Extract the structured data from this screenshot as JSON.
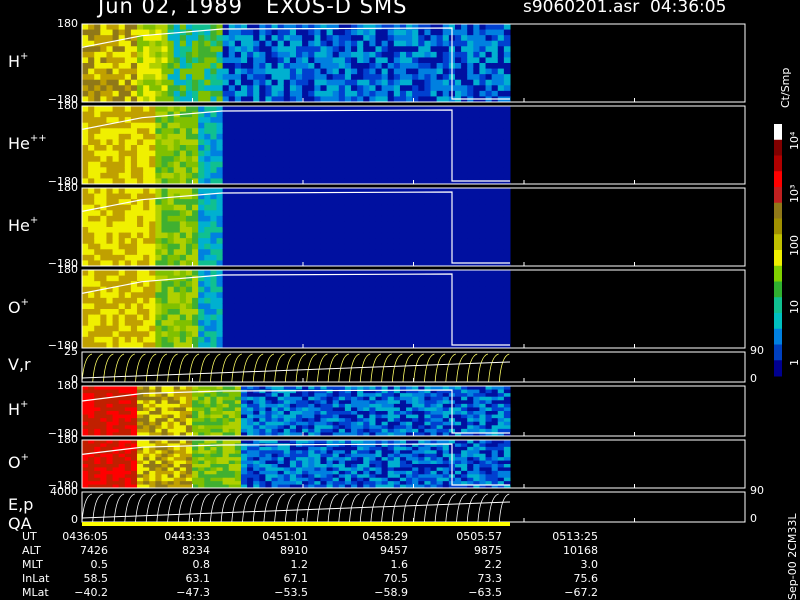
{
  "header": {
    "title": "Jun 02, 1989   EXOS-D SMS",
    "file_time": "s9060201.asr  04:36:05"
  },
  "colors": {
    "background": "#000000",
    "frame": "#ffffff",
    "spectrogram_low": "#000080",
    "spectrogram_high": "#ff0000",
    "trace": "#ffffff",
    "qa_bar": "#ffff00"
  },
  "panels": [
    {
      "label": "H+",
      "top_tick": "180",
      "bottom_tick": "−180"
    },
    {
      "label": "He++",
      "top_tick": "180",
      "bottom_tick": "−180"
    },
    {
      "label": "He+",
      "top_tick": "180",
      "bottom_tick": "−180"
    },
    {
      "label": "O+",
      "top_tick": "180",
      "bottom_tick": "−180"
    },
    {
      "label": "V,r",
      "top_tick": "25",
      "bottom_tick": "0",
      "right_top": "90",
      "right_bottom": "0"
    },
    {
      "label": "H+",
      "top_tick": "180",
      "bottom_tick": "−180"
    },
    {
      "label": "O+",
      "top_tick": "180",
      "bottom_tick": "−180"
    },
    {
      "label": "E,p",
      "label2": "QA",
      "top_tick": "4000",
      "bottom_tick": "0",
      "right_top": "90",
      "right_bottom": "0"
    }
  ],
  "colorbar": {
    "title": "Ct/Smp",
    "labels": [
      "10⁴",
      "10³",
      "100",
      "10",
      "1"
    ]
  },
  "footer": {
    "rows": [
      {
        "label": "UT",
        "values": [
          "0436:05",
          "0443:33",
          "0451:01",
          "0458:29",
          "0505:57",
          "0513:25"
        ]
      },
      {
        "label": "ALT",
        "values": [
          "7426",
          "8234",
          "8910",
          "9457",
          "9875",
          "10168"
        ]
      },
      {
        "label": "MLT",
        "values": [
          "0.5",
          "0.8",
          "1.2",
          "1.6",
          "2.2",
          "3.0"
        ]
      },
      {
        "label": "InLat",
        "values": [
          "58.5",
          "63.1",
          "67.1",
          "70.5",
          "73.3",
          "75.6"
        ]
      },
      {
        "label": "MLat",
        "values": [
          "−40.2",
          "−47.3",
          "−53.5",
          "−58.9",
          "−63.5",
          "−67.2"
        ]
      }
    ]
  },
  "side_note": "Sep-00  2CM33L",
  "chart_data": {
    "type": "heatmap",
    "title": "Jun 02, 1989   EXOS-D SMS",
    "x": [
      "0436:05",
      "0443:33",
      "0451:01",
      "0458:29",
      "0505:57",
      "0513:25"
    ],
    "colorbar_label": "Ct/Smp",
    "colorbar_scale": "log",
    "colorbar_range": [
      1,
      10000
    ],
    "panels": [
      {
        "name": "H+",
        "ylim": [
          -180,
          180
        ]
      },
      {
        "name": "He++",
        "ylim": [
          -180,
          180
        ]
      },
      {
        "name": "He+",
        "ylim": [
          -180,
          180
        ]
      },
      {
        "name": "O+",
        "ylim": [
          -180,
          180
        ]
      },
      {
        "name": "V,r",
        "ylim": [
          0,
          25
        ],
        "right_ylim": [
          0,
          90
        ]
      },
      {
        "name": "H+",
        "ylim": [
          -180,
          180
        ]
      },
      {
        "name": "O+",
        "ylim": [
          -180,
          180
        ]
      },
      {
        "name": "E,p",
        "ylim": [
          0,
          4000
        ],
        "right_ylim": [
          0,
          90
        ]
      }
    ]
  }
}
